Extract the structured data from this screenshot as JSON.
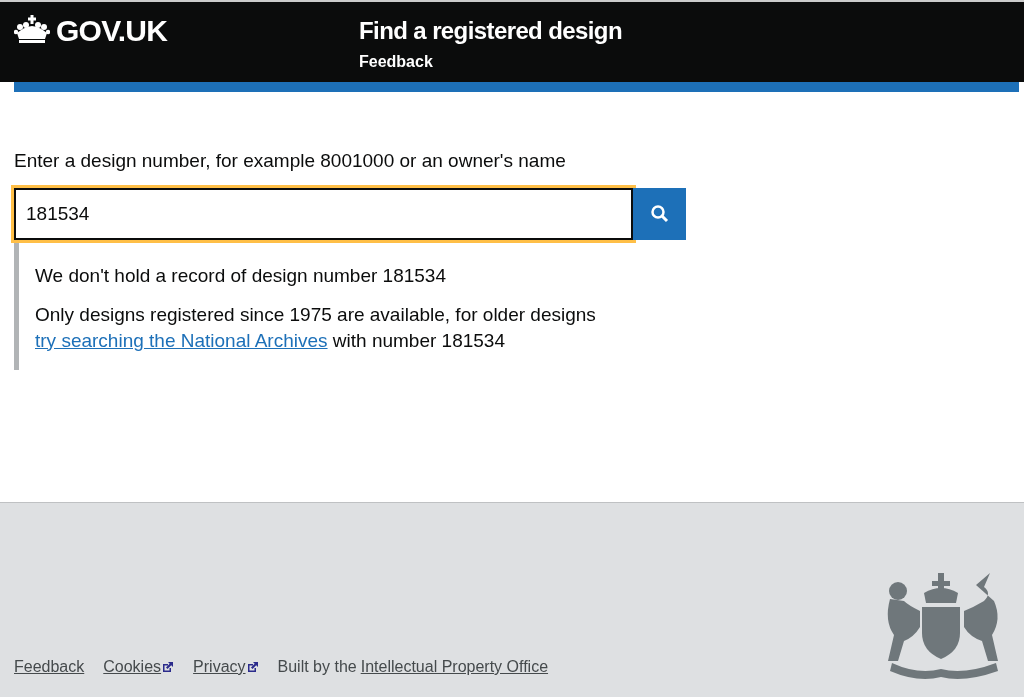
{
  "header": {
    "logo": "GOV.UK",
    "service_name": "Find a registered design",
    "nav_link": "Feedback"
  },
  "search": {
    "label": "Enter a design number, for example 8001000 or an owner's name",
    "value": "181534",
    "focused": true
  },
  "notice": {
    "heading": "We don't hold a record of design number 181534",
    "text_before": "Only designs registered since 1975 are available, for older designs",
    "link": "try searching the National Archives",
    "text_after": "with number 181534"
  },
  "footer": {
    "links": [
      {
        "label": "Feedback",
        "external": false
      },
      {
        "label": "Cookies",
        "external": true
      },
      {
        "label": "Privacy",
        "external": true
      }
    ],
    "credit": "Built by the",
    "credit_link": "Intellectual Property Office"
  }
}
